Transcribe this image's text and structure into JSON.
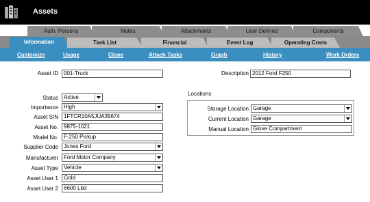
{
  "app": {
    "title": "Assets"
  },
  "tabs_top": [
    "Auth. Persons",
    "Notes",
    "Attachments",
    "User Defined",
    "Components"
  ],
  "tabs_main": [
    "Information",
    "Task List",
    "Financial",
    "Event Log",
    "Operating Costs"
  ],
  "actions": [
    "Customize",
    "Usage",
    "Clone",
    "Attach Tasks",
    "Graph",
    "History",
    "Work Orders"
  ],
  "form": {
    "asset_id": {
      "label": "Asset ID",
      "value": "001-Truck"
    },
    "description": {
      "label": "Description",
      "value": "2012 Ford F250"
    },
    "status": {
      "label": "Status",
      "value": "Active"
    },
    "importance": {
      "label": "Importance",
      "value": "High"
    },
    "asset_sn": {
      "label": "Asset S/N",
      "value": "1FTCR10A5JUA35674"
    },
    "asset_no": {
      "label": "Asset No.",
      "value": "9875-1021"
    },
    "model_no": {
      "label": "Model No.",
      "value": "F-250 Pickup"
    },
    "supplier_code": {
      "label": "Supplier Code",
      "value": "Jones Ford"
    },
    "manufacturer": {
      "label": "Manufacturer",
      "value": "Ford Motor Company"
    },
    "asset_type": {
      "label": "Asset Type",
      "value": "Vehicle"
    },
    "asset_user1": {
      "label": "Asset User 1",
      "value": "Gold"
    },
    "asset_user2": {
      "label": "Asset User 2",
      "value": "6600 Lbd"
    }
  },
  "locations": {
    "title": "Locations",
    "storage": {
      "label": "Storage Location",
      "value": "Garage"
    },
    "current": {
      "label": "Current Location",
      "value": "Garage"
    },
    "manual": {
      "label": "Manual Location",
      "value": "Glove Compartment"
    }
  },
  "colors": {
    "accent": "#3a8fc0",
    "titlebar": "#000000",
    "tab_inactive": "#bdbdbd",
    "tab_back": "#8d8d8d"
  }
}
